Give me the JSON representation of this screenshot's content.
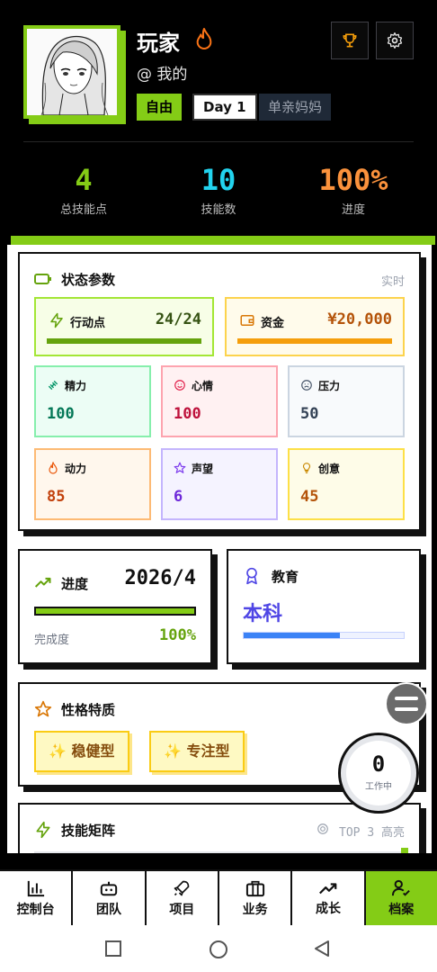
{
  "profile": {
    "name": "玩家",
    "handle": "@ 我的",
    "tags": [
      "自由",
      "Day 1",
      "单亲妈妈"
    ]
  },
  "summary": [
    {
      "value": "4",
      "label": "总技能点"
    },
    {
      "value": "10",
      "label": "技能数"
    },
    {
      "value": "100%",
      "label": "进度"
    }
  ],
  "status": {
    "title": "状态参数",
    "realtime": "实时",
    "action": {
      "label": "行动点",
      "value": "24/24",
      "fill": 1.0
    },
    "funds": {
      "label": "资金",
      "value": "¥20,000",
      "fill": 1.0
    },
    "params": [
      {
        "label": "精力",
        "value": "100"
      },
      {
        "label": "心情",
        "value": "100"
      },
      {
        "label": "压力",
        "value": "50"
      },
      {
        "label": "动力",
        "value": "85"
      },
      {
        "label": "声望",
        "value": "6"
      },
      {
        "label": "创意",
        "value": "45"
      }
    ]
  },
  "progress": {
    "title": "进度",
    "date": "2026/4",
    "done_label": "完成度",
    "percent": "100%",
    "fill": 1.0
  },
  "education": {
    "title": "教育",
    "value": "本科",
    "fill": 0.6
  },
  "traits": {
    "title": "性格特质",
    "items": [
      "✨ 稳健型",
      "✨ 专注型"
    ]
  },
  "skills": {
    "title": "技能矩阵",
    "badge": "TOP 3 高亮"
  },
  "work": {
    "count": "0",
    "label": "工作中"
  },
  "nav": [
    {
      "label": "控制台",
      "icon": "bar-chart-icon"
    },
    {
      "label": "团队",
      "icon": "robot-icon"
    },
    {
      "label": "项目",
      "icon": "rocket-icon"
    },
    {
      "label": "业务",
      "icon": "briefcase-icon"
    },
    {
      "label": "成长",
      "icon": "trend-up-icon"
    },
    {
      "label": "档案",
      "icon": "user-check-icon"
    }
  ],
  "colors": {
    "accent": "#84cc16",
    "cyan": "#22d3ee",
    "orange": "#fb923c"
  }
}
